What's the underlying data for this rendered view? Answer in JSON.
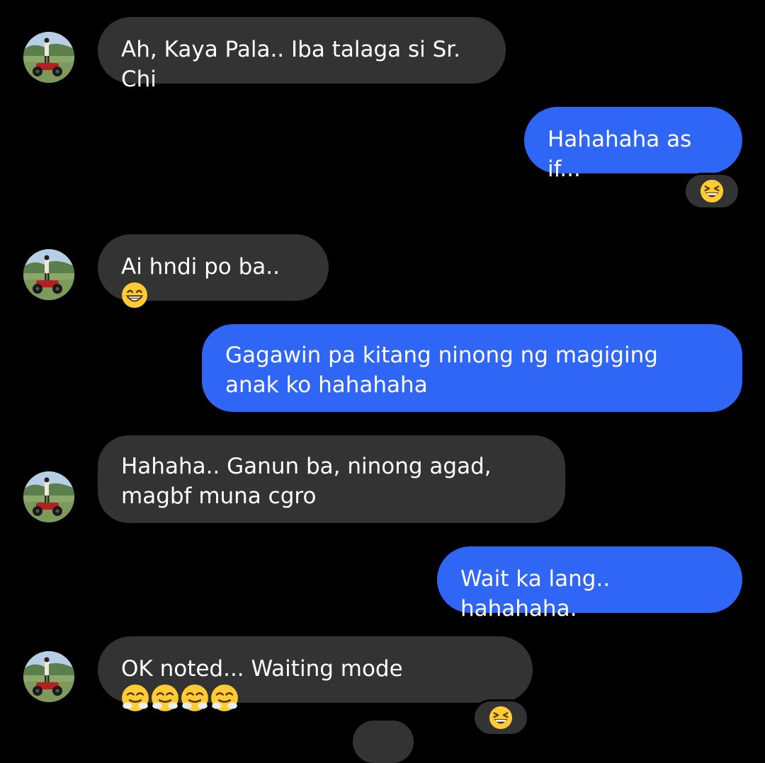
{
  "colors": {
    "background": "#000000",
    "incoming_bubble": "#333333",
    "outgoing_bubble": "#2f66f5",
    "text": "#ffffff"
  },
  "messages": [
    {
      "direction": "in",
      "text": "Ah, Kaya Pala.. Iba talaga si Sr. Chi"
    },
    {
      "direction": "out",
      "text": "Hahahaha as if...",
      "reaction": "laughing-squinting-face-emoji"
    },
    {
      "direction": "in",
      "text": "Ai hndi po ba..",
      "trailing_emoji": "grinning-face-emoji"
    },
    {
      "direction": "out",
      "text": "Gagawin pa kitang ninong ng magiging anak ko hahahaha"
    },
    {
      "direction": "in",
      "text": "Hahaha.. Ganun ba, ninong agad, magbf muna cgro"
    },
    {
      "direction": "out",
      "text": "Wait ka lang.. hahahaha."
    },
    {
      "direction": "in",
      "text": "OK noted... Waiting mode",
      "trailing_emoji": "face-with-steam-emoji x4",
      "reaction": "laughing-squinting-face-emoji"
    }
  ]
}
